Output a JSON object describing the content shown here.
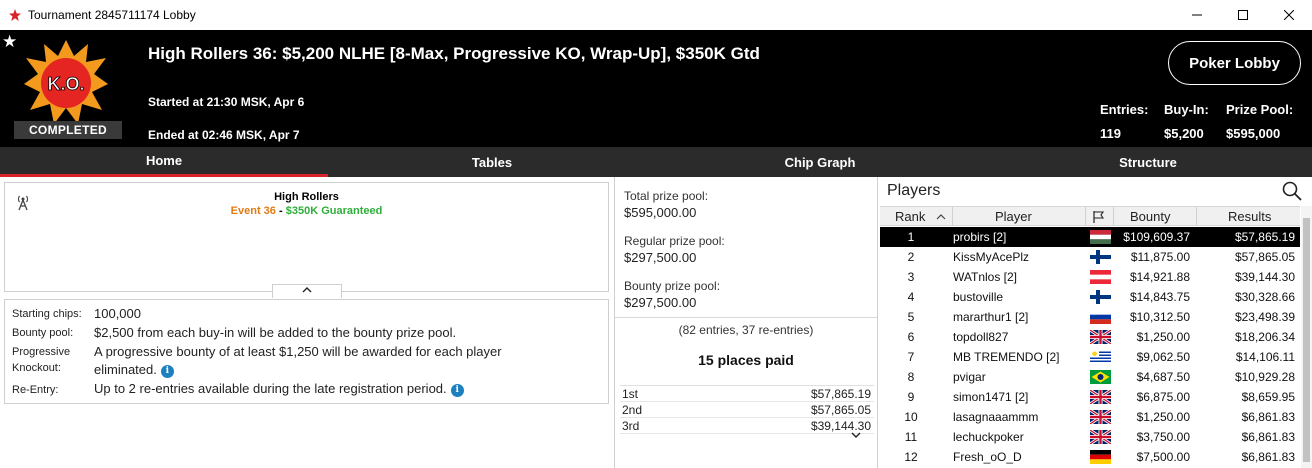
{
  "window": {
    "title": "Tournament 2845711174 Lobby",
    "minimize": "—",
    "maximize": "☐",
    "close": "✕"
  },
  "header": {
    "logo_text": "K.O.",
    "status": "COMPLETED",
    "title": "High Rollers 36: $5,200 NLHE [8-Max, Progressive KO, Wrap-Up], $350K Gtd",
    "started": "Started at 21:30 MSK, Apr 6",
    "ended": "Ended at 02:46 MSK, Apr 7",
    "lobby_button": "Poker Lobby",
    "entries_label": "Entries:",
    "entries_value": "119",
    "buyin_label": "Buy-In:",
    "buyin_value": "$5,200",
    "prizepool_label": "Prize Pool:",
    "prizepool_value": "$595,000"
  },
  "tabs": [
    {
      "label": "Home",
      "active": true
    },
    {
      "label": "Tables",
      "active": false
    },
    {
      "label": "Chip Graph",
      "active": false
    },
    {
      "label": "Structure",
      "active": false
    }
  ],
  "event": {
    "name": "High Rollers",
    "event_no": "Event 36",
    "dash": "-",
    "guarantee": "$350K Guaranteed",
    "collapse": "^"
  },
  "info": {
    "starting_chips_label": "Starting chips:",
    "starting_chips_value": "100,000",
    "bounty_pool_label": "Bounty pool:",
    "bounty_pool_value": "$2,500 from each buy-in will be added to the bounty prize pool.",
    "prog_label_1": "Progressive",
    "prog_label_2": "Knockout:",
    "prog_value_1": "A progressive bounty of at least $1,250 will be awarded for each player",
    "prog_value_2": "eliminated.",
    "reentry_label": "Re-Entry:",
    "reentry_value": "Up to 2 re-entries available during the late registration period.",
    "info_icon": "i"
  },
  "prize": {
    "total_label": "Total prize pool:",
    "total_value": "$595,000.00",
    "regular_label": "Regular prize pool:",
    "regular_value": "$297,500.00",
    "bounty_label": "Bounty prize pool:",
    "bounty_value": "$297,500.00",
    "entries_note": "(82 entries, 37 re-entries)",
    "places_paid": "15 places paid",
    "payouts": [
      {
        "place": "1st",
        "amount": "$57,865.19"
      },
      {
        "place": "2nd",
        "amount": "$57,865.05"
      },
      {
        "place": "3rd",
        "amount": "$39,144.30"
      }
    ],
    "more": "⌵"
  },
  "players": {
    "title": "Players",
    "columns": {
      "rank": "Rank",
      "rank_sort": "^",
      "player": "Player",
      "bounty": "Bounty",
      "results": "Results"
    },
    "rows": [
      {
        "rank": "1",
        "name": "probirs [2]",
        "flag": "hungary",
        "bounty": "$109,609.37",
        "result": "$57,865.19",
        "selected": true
      },
      {
        "rank": "2",
        "name": "KissMyAcePlz",
        "flag": "finland",
        "bounty": "$11,875.00",
        "result": "$57,865.05"
      },
      {
        "rank": "3",
        "name": "WATnlos [2]",
        "flag": "austria",
        "bounty": "$14,921.88",
        "result": "$39,144.30"
      },
      {
        "rank": "4",
        "name": "bustoville",
        "flag": "finland",
        "bounty": "$14,843.75",
        "result": "$30,328.66"
      },
      {
        "rank": "5",
        "name": "mararthur1 [2]",
        "flag": "russia",
        "bounty": "$10,312.50",
        "result": "$23,498.39"
      },
      {
        "rank": "6",
        "name": "topdoll827",
        "flag": "uk",
        "bounty": "$1,250.00",
        "result": "$18,206.34"
      },
      {
        "rank": "7",
        "name": "MB TREMENDO [2]",
        "flag": "uruguay",
        "bounty": "$9,062.50",
        "result": "$14,106.11"
      },
      {
        "rank": "8",
        "name": "pvigar",
        "flag": "brazil",
        "bounty": "$4,687.50",
        "result": "$10,929.28"
      },
      {
        "rank": "9",
        "name": "simon1471 [2]",
        "flag": "uk",
        "bounty": "$6,875.00",
        "result": "$8,659.95"
      },
      {
        "rank": "10",
        "name": "lasagnaaammm",
        "flag": "uk",
        "bounty": "$1,250.00",
        "result": "$6,861.83"
      },
      {
        "rank": "11",
        "name": "lechuckpoker",
        "flag": "uk",
        "bounty": "$3,750.00",
        "result": "$6,861.83"
      },
      {
        "rank": "12",
        "name": "Fresh_oO_D",
        "flag": "germany",
        "bounty": "$7,500.00",
        "result": "$6,861.83"
      }
    ]
  },
  "colors": {
    "accent_red": "#d8232a",
    "event_orange": "#e07b16",
    "gtd_green": "#2fae3a",
    "info_blue": "#1c7fc0"
  }
}
